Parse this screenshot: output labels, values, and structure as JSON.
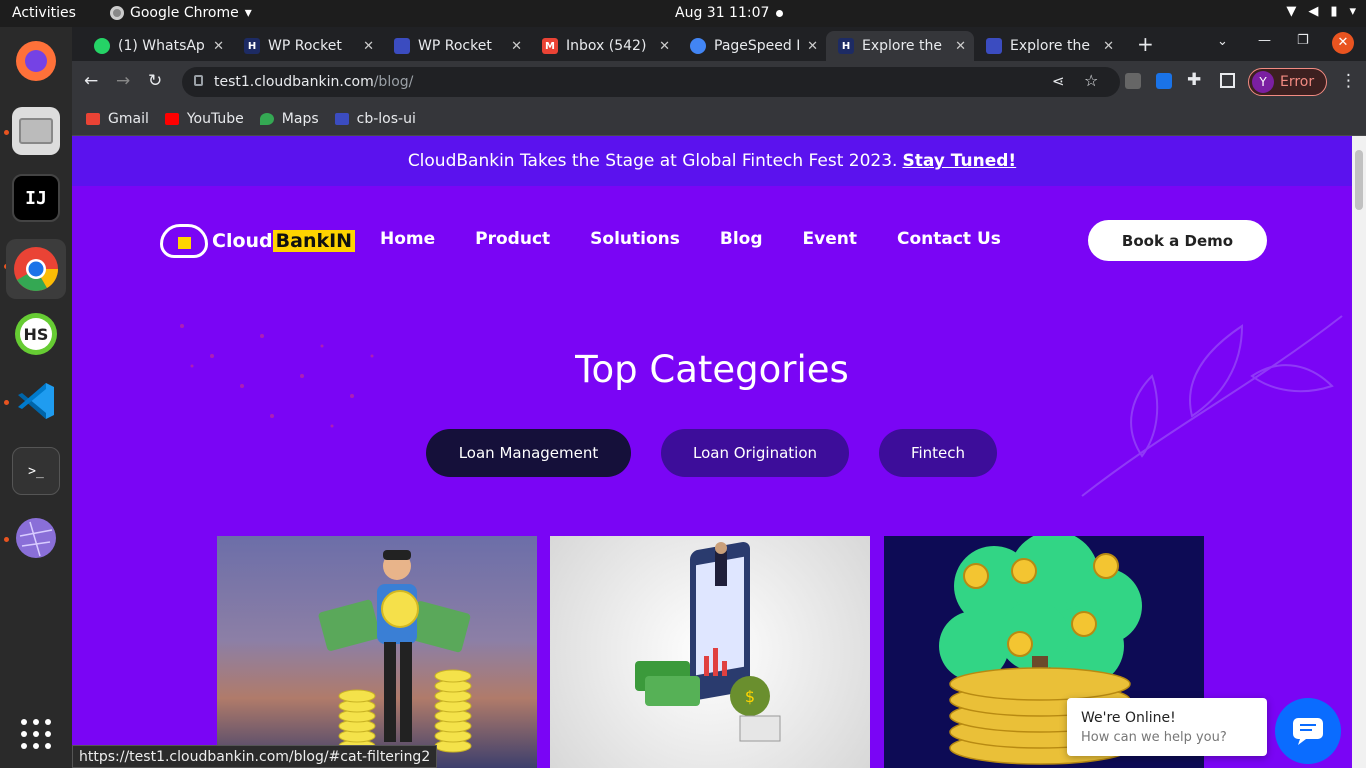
{
  "system": {
    "activities": "Activities",
    "app_name": "Google Chrome",
    "clock": "Aug 31  11:07"
  },
  "tabs": [
    {
      "title": "(1) WhatsAp",
      "color": "#25d366"
    },
    {
      "title": "WP Rocket",
      "color": "#1d2b64"
    },
    {
      "title": "WP Rocket",
      "color": "#3b4cc0"
    },
    {
      "title": "Inbox (542)",
      "color": "#ea4335"
    },
    {
      "title": "PageSpeed I",
      "color": "#4285f4"
    },
    {
      "title": "Explore the",
      "color": "#1d2b64"
    },
    {
      "title": "Explore the",
      "color": "#3b4cc0"
    }
  ],
  "browser": {
    "url_host": "test1.cloudbankin.com",
    "url_path": "/blog/",
    "profile_label": "Error",
    "profile_initial": "Y"
  },
  "bookmarks": [
    {
      "label": "Gmail",
      "color": "#ea4335"
    },
    {
      "label": "YouTube",
      "color": "#ff0000"
    },
    {
      "label": "Maps",
      "color": "#34a853"
    },
    {
      "label": "cb-los-ui",
      "color": "#3b4cc0"
    }
  ],
  "page": {
    "announcement": "CloudBankin Takes the Stage at Global Fintech Fest 2023.",
    "announcement_link": "Stay Tuned!",
    "logo_cloud": "Cloud",
    "logo_bank": "BankIN",
    "nav": [
      "Home",
      "Product",
      "Solutions",
      "Blog",
      "Event",
      "Contact Us"
    ],
    "cta": "Book a Demo",
    "heading": "Top Categories",
    "categories": [
      "Loan Management",
      "Loan Origination",
      "Fintech"
    ]
  },
  "status_url": "https://test1.cloudbankin.com/blog/#cat-filtering2",
  "chat": {
    "title": "We're Online!",
    "subtitle": "How can we help you?"
  },
  "colors": {
    "page_bg": "#7a05f5",
    "banner_bg": "#5b12ee",
    "accent_yellow": "#ffd400"
  }
}
